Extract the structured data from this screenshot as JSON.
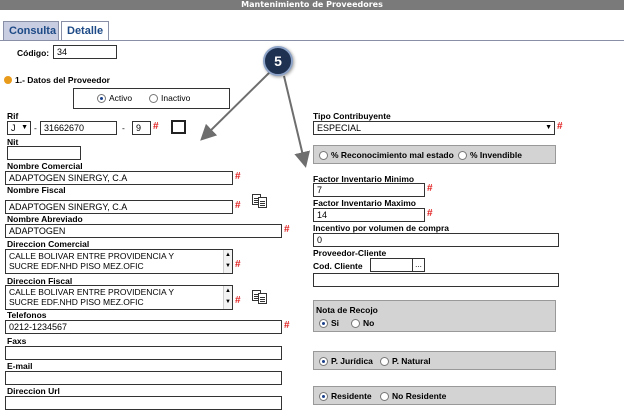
{
  "window": {
    "title": "Mantenimiento de Proveedores"
  },
  "tabs": [
    {
      "label": "Consulta"
    },
    {
      "label": "Detalle"
    }
  ],
  "codigo": {
    "label": "Código:",
    "value": "34"
  },
  "section": {
    "title": "1.- Datos del Proveedor"
  },
  "status": {
    "options": [
      "Activo",
      "Inactivo"
    ],
    "selected": "Activo"
  },
  "rif": {
    "label": "Rif",
    "prefix": "J",
    "dash": "-",
    "number": "31662670",
    "dash2": "-",
    "digit": "9"
  },
  "nit": {
    "label": "Nit",
    "value": ""
  },
  "nombre_comercial": {
    "label": "Nombre Comercial",
    "value": "ADAPTOGEN SINERGY, C.A"
  },
  "nombre_fiscal": {
    "label": "Nombre Fiscal",
    "value": "ADAPTOGEN SINERGY, C.A"
  },
  "nombre_abreviado": {
    "label": "Nombre Abreviado",
    "value": "ADAPTOGEN"
  },
  "direccion_comercial": {
    "label": "Direccion Comercial",
    "line1": "CALLE BOLIVAR ENTRE PROVIDENCIA Y",
    "line2": "SUCRE EDF.NHD PISO MEZ.OFIC"
  },
  "direccion_fiscal": {
    "label": "Direccion Fiscal",
    "line1": "CALLE BOLIVAR ENTRE PROVIDENCIA Y",
    "line2": "SUCRE EDF.NHD PISO MEZ.OFIC"
  },
  "telefonos": {
    "label": "Telefonos",
    "value": "0212-1234567"
  },
  "faxs": {
    "label": "Faxs",
    "value": ""
  },
  "email": {
    "label": "E-mail",
    "value": ""
  },
  "direccion_url": {
    "label": "Direccion Url",
    "value": ""
  },
  "tipo_contribuyente": {
    "label": "Tipo Contribuyente",
    "value": "ESPECIAL"
  },
  "reconocimiento": {
    "options": [
      "% Reconocimiento mal estado",
      "% Invendible"
    ]
  },
  "factor_min": {
    "label": "Factor Inventario Minimo",
    "value": "7"
  },
  "factor_max": {
    "label": "Factor Inventario Maximo",
    "value": "14"
  },
  "incentivo": {
    "label": "Incentivo por volumen de compra",
    "value": "0"
  },
  "proveedor_cliente": {
    "label": "Proveedor-Cliente",
    "cod_label": "Cod. Cliente",
    "cod_value": "",
    "lookup": "...",
    "name_value": ""
  },
  "nota_recojo": {
    "label": "Nota de Recojo",
    "options": [
      "Si",
      "No"
    ],
    "selected": "Si"
  },
  "persona": {
    "options": [
      "P. Jurídica",
      "P. Natural"
    ],
    "selected": "P. Jurídica"
  },
  "residencia": {
    "options": [
      "Residente",
      "No Residente"
    ],
    "selected": "Residente"
  },
  "required_mark": "#",
  "callout": {
    "number": "5"
  }
}
